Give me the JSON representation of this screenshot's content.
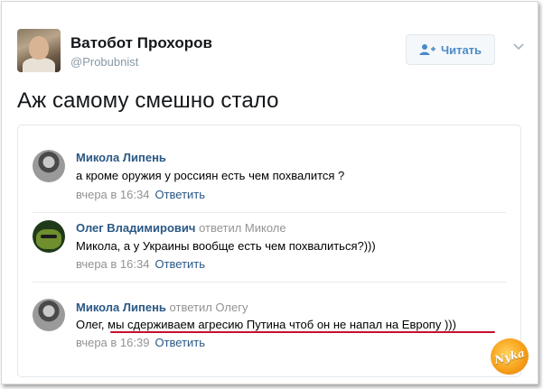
{
  "tweet": {
    "author_name": "Ватобот Прохоров",
    "author_handle": "@Probubnist",
    "follow_label": "Читать",
    "text": "Аж самому смешно стало"
  },
  "comments": [
    {
      "author": "Микола Липень",
      "replied_to": "",
      "text": "а кроме оружия у россиян есть чем похвалится ?",
      "time": "вчера в 16:34",
      "reply_label": "Ответить"
    },
    {
      "author": "Олег Владимирович",
      "replied_to": "ответил Миколе",
      "text": "Микола, а у Украины вообще есть чем похвалиться?)))",
      "time": "вчера в 16:34",
      "reply_label": "Ответить"
    },
    {
      "author": "Микола Липень",
      "replied_to": "ответил Олегу",
      "text": "Олег, мы сдерживаем агресию Путина чтоб он не напал на Европу )))",
      "time": "вчера в 16:39",
      "reply_label": "Ответить"
    }
  ],
  "watermark": {
    "text": "Nyka"
  },
  "colors": {
    "link": "#2a5885",
    "underline": "#c8102e",
    "follow_text": "#4a8bc9"
  }
}
